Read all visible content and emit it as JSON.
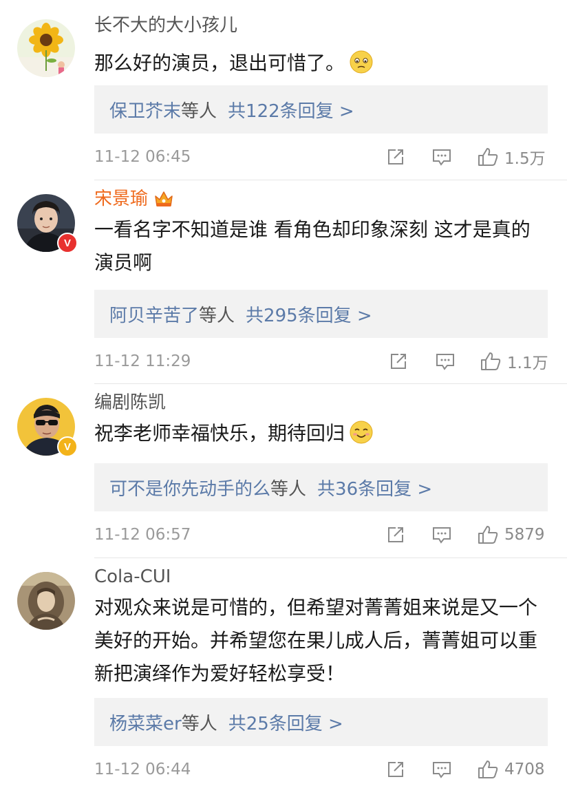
{
  "comments": [
    {
      "username": "长不大的大小孩儿",
      "text": "那么好的演员，退出可惜了。",
      "emoji": "sad-emoji",
      "reply_names": "保卫芥末",
      "reply_sep": "等人",
      "reply_count": "共122条回复 >",
      "time": "11-12 06:45",
      "likes": "1.5万"
    },
    {
      "username": "宋景瑜",
      "text": "一看名字不知道是谁 看角色却印象深刻 这才是真的演员啊",
      "reply_names": "阿贝辛苦了",
      "reply_sep": "等人",
      "reply_count": "共295条回复 >",
      "time": "11-12 11:29",
      "likes": "1.1万",
      "verified": "V"
    },
    {
      "username": "编剧陈凯",
      "text": "祝李老师幸福快乐，期待回归",
      "emoji": "smile-emoji",
      "reply_names": "可不是你先动手的么",
      "reply_sep": "等人",
      "reply_count": "共36条回复 >",
      "time": "11-12 06:57",
      "likes": "5879",
      "verified": "V"
    },
    {
      "username": "Cola-CUI",
      "text": "对观众来说是可惜的，但希望对菁菁姐来说是又一个美好的开始。并希望您在果儿成人后，菁菁姐可以重新把演绎作为爱好轻松享受！",
      "reply_names": "杨菜菜er",
      "reply_sep": "等人",
      "reply_count": "共25条回复 >",
      "time": "11-12 06:44",
      "likes": "4708"
    }
  ],
  "colors": {
    "vip_name": "#ef6a1d",
    "link": "#5b7aa8",
    "badge_red": "#e8312f",
    "badge_gold": "#f3b31a"
  },
  "icons": [
    "share-icon",
    "comment-icon",
    "like-icon",
    "vip-crown-icon"
  ]
}
